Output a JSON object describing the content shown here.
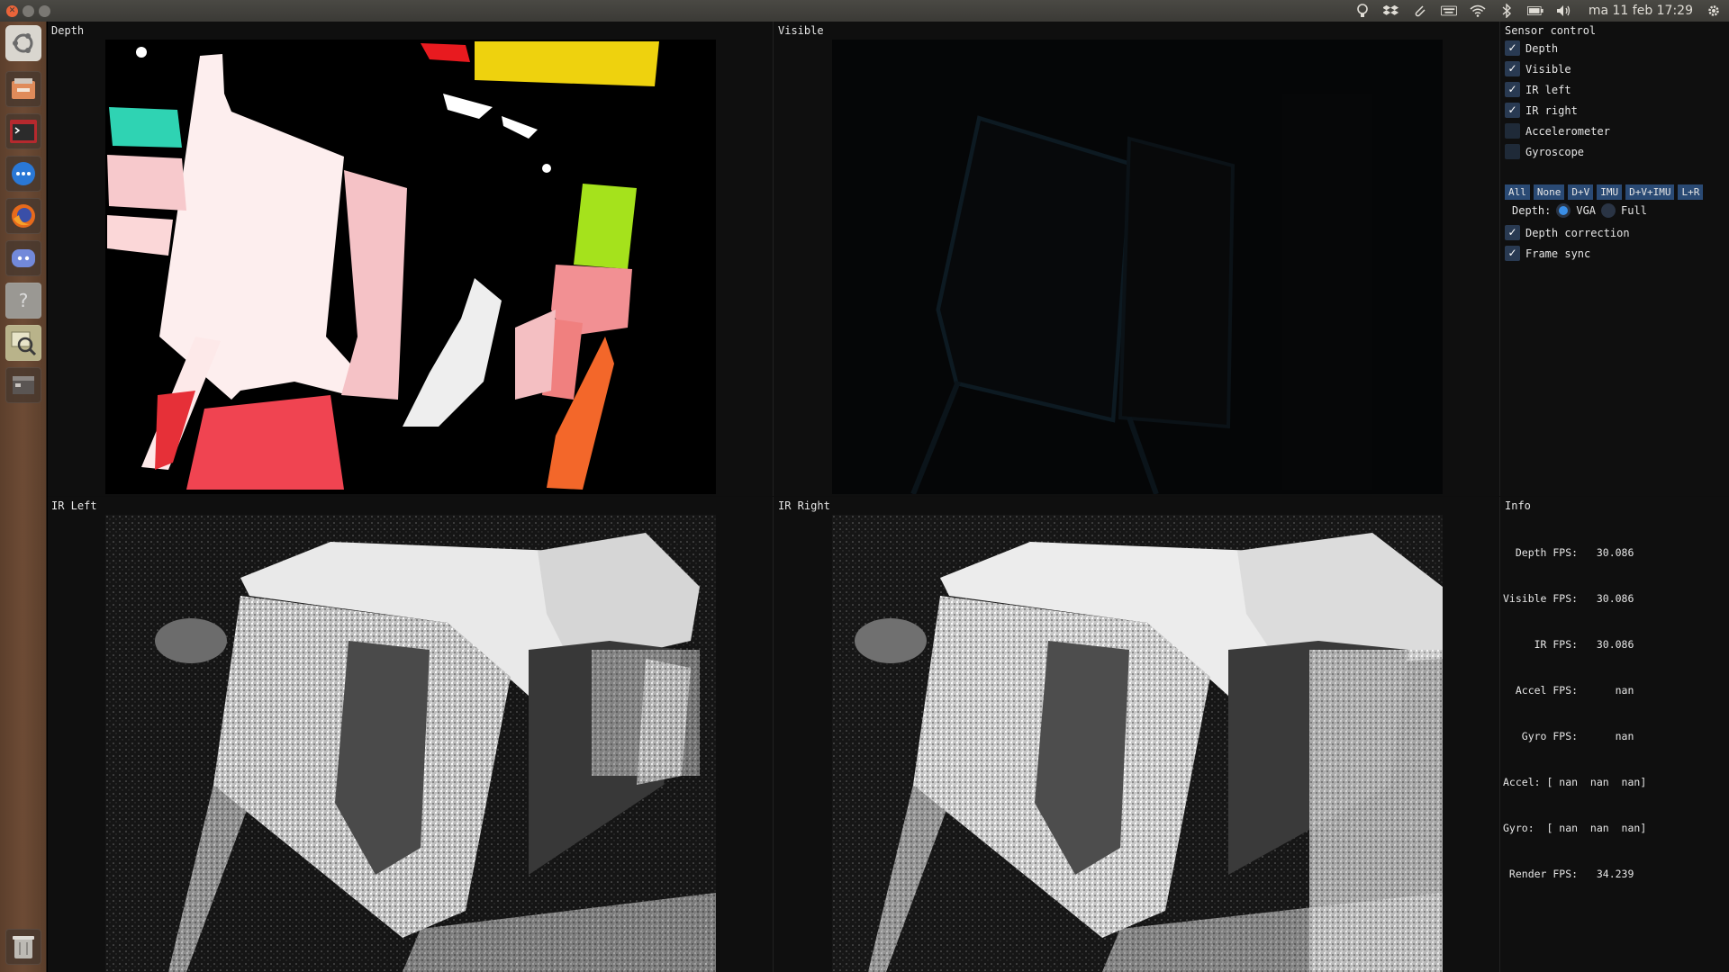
{
  "top_panel": {
    "clock": "ma 11 feb 17:29",
    "tray_icons": [
      "lightbulb-icon",
      "dropbox-icon",
      "paperclip-icon",
      "keyboard-icon",
      "wifi-icon",
      "bluetooth-icon",
      "battery-icon",
      "volume-icon",
      "settings-gear-icon"
    ]
  },
  "launcher": {
    "items": [
      "ubuntu-logo-icon",
      "files-icon",
      "terminal-icon",
      "messaging-icon",
      "firefox-icon",
      "discord-icon",
      "help-icon",
      "image-viewer-icon",
      "window-icon",
      "trash-icon"
    ]
  },
  "panels": {
    "depth": "Depth",
    "visible": "Visible",
    "ir_left": "IR Left",
    "ir_right": "IR Right"
  },
  "sensor_control": {
    "title": "Sensor control",
    "checks": [
      {
        "label": "Depth",
        "checked": true
      },
      {
        "label": "Visible",
        "checked": true
      },
      {
        "label": "IR left",
        "checked": true
      },
      {
        "label": "IR right",
        "checked": true
      },
      {
        "label": "Accelerometer",
        "checked": false
      },
      {
        "label": "Gyroscope",
        "checked": false
      }
    ],
    "buttons": [
      "All",
      "None",
      "D+V",
      "IMU",
      "D+V+IMU",
      "L+R"
    ],
    "depth_label": "Depth:",
    "depth_options": [
      {
        "label": "VGA",
        "selected": true
      },
      {
        "label": "Full",
        "selected": false
      }
    ],
    "extra_checks": [
      {
        "label": "Depth correction",
        "checked": true
      },
      {
        "label": "Frame sync",
        "checked": true
      }
    ]
  },
  "info": {
    "title": "Info",
    "lines": [
      "  Depth FPS:   30.086",
      "Visible FPS:   30.086",
      "     IR FPS:   30.086",
      "  Accel FPS:      nan",
      "   Gyro FPS:      nan",
      "Accel: [ nan  nan  nan]",
      "Gyro:  [ nan  nan  nan]",
      " Render FPS:   34.239"
    ]
  }
}
